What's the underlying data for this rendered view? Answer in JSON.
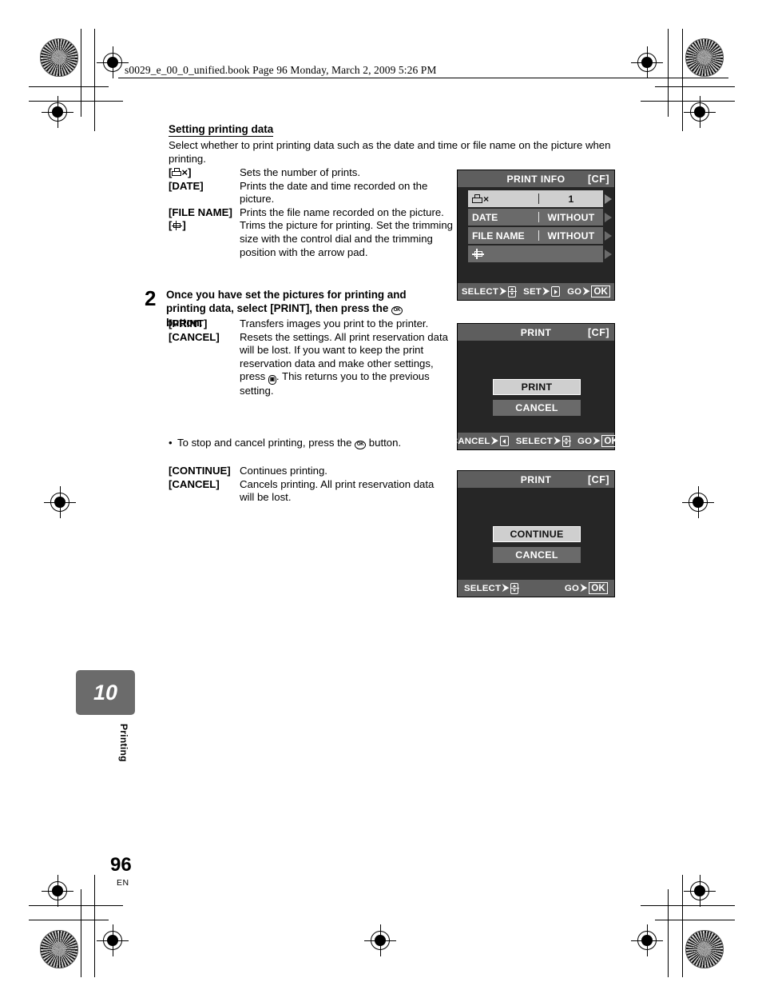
{
  "header": {
    "text": "s0029_e_00_0_unified.book  Page 96  Monday, March 2, 2009  5:26 PM"
  },
  "section": {
    "title": "Setting printing data",
    "intro": "Select whether to print printing data such as the date and time or file name on the picture when printing."
  },
  "print_info_defs": [
    {
      "term_prefix": "[",
      "term_icon": "printer-icon",
      "term_suffix": "×]",
      "desc": "Sets the number of prints."
    },
    {
      "term": "[DATE]",
      "desc": "Prints the date and time recorded on the picture."
    },
    {
      "term": "[FILE NAME]",
      "desc": "Prints the file name recorded on the picture."
    },
    {
      "term_prefix": "[",
      "term_icon": "trim-icon",
      "term_suffix": "]",
      "desc": "Trims the picture for printing. Set the trimming size with the control dial and the trimming position with the arrow pad."
    }
  ],
  "step2": {
    "number": "2",
    "text_before": "Once you have set the pictures for printing and printing data, select [PRINT], then press the ",
    "ok_glyph": "OK",
    "text_after": " button."
  },
  "print_defs": [
    {
      "term": "[PRINT]",
      "desc": "Transfers images you print to the printer."
    },
    {
      "term": "[CANCEL]",
      "desc_part1": "Resets the settings. All print reservation data will be lost. If you want to keep the print reservation data and make other settings, press ",
      "menu_glyph": "MENU",
      "desc_part2": ". This returns you to the previous setting."
    }
  ],
  "bullet_note": {
    "bullet": "•",
    "text_before": "To stop and cancel printing, press the ",
    "ok_glyph": "OK",
    "text_after": " button."
  },
  "continue_defs": [
    {
      "term": "[CONTINUE]",
      "desc": "Continues printing."
    },
    {
      "term": "[CANCEL]",
      "desc": "Cancels printing. All print reservation data will be lost."
    }
  ],
  "lcd_print_info": {
    "title": "PRINT INFO",
    "card_badge": "[CF]",
    "rows": [
      {
        "icon": "printer-icon",
        "label": "×",
        "value": "1",
        "selected": true
      },
      {
        "label": "DATE",
        "value": "WITHOUT",
        "selected": false
      },
      {
        "label": "FILE NAME",
        "value": "WITHOUT",
        "selected": false
      },
      {
        "icon": "trim-icon",
        "label": "",
        "value": "",
        "selected": false
      }
    ],
    "footer": [
      {
        "label": "SELECT",
        "arrow": "⮞",
        "key": "updown-key-icon"
      },
      {
        "label": "SET",
        "arrow": "⮞",
        "key": "right-key-icon"
      },
      {
        "label": "GO",
        "arrow": "⮞",
        "key": "ok-key",
        "key_text": "OK"
      }
    ]
  },
  "lcd_print": {
    "title": "PRINT",
    "card_badge": "[CF]",
    "buttons": [
      {
        "label": "PRINT",
        "selected": true
      },
      {
        "label": "CANCEL",
        "selected": false
      }
    ],
    "footer": [
      {
        "label": "CANCEL",
        "arrow": "⮞",
        "key": "left-key-icon"
      },
      {
        "label": "SELECT",
        "arrow": "⮞",
        "key": "updown-key-icon"
      },
      {
        "label": "GO",
        "arrow": "⮞",
        "key": "ok-key",
        "key_text": "OK"
      }
    ]
  },
  "lcd_continue": {
    "title": "PRINT",
    "card_badge": "[CF]",
    "buttons": [
      {
        "label": "CONTINUE",
        "selected": true
      },
      {
        "label": "CANCEL",
        "selected": false
      }
    ],
    "footer": [
      {
        "label": "SELECT",
        "arrow": "⮞",
        "key": "updown-key-icon"
      },
      {
        "label": "GO",
        "arrow": "⮞",
        "key": "ok-key",
        "key_text": "OK"
      }
    ]
  },
  "chapter": {
    "number": "10",
    "label": "Printing"
  },
  "folio": {
    "page": "96",
    "language": "EN"
  },
  "colors": {
    "lcd_background": "#262626",
    "lcd_bar": "#5e5e5e",
    "lcd_row_unselected": "#6a6a6a",
    "lcd_row_selected": "#cfcfcf",
    "chapter_tab": "#6b6b6b"
  }
}
